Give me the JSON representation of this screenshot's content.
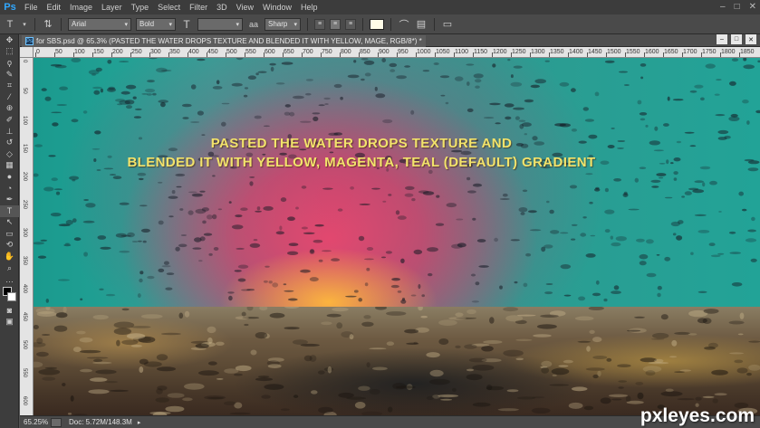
{
  "app": {
    "logo": "Ps"
  },
  "menu": [
    "File",
    "Edit",
    "Image",
    "Layer",
    "Type",
    "Select",
    "Filter",
    "3D",
    "View",
    "Window",
    "Help"
  ],
  "window_controls": [
    "–",
    "□",
    "✕"
  ],
  "options": {
    "font_family": "Arial",
    "font_style": "Bold",
    "font_size": "",
    "antialias": "Sharp",
    "color": "#fffde8"
  },
  "tools": [
    "move-icon",
    "marquee-icon",
    "lasso-icon",
    "quick-select-icon",
    "crop-icon",
    "eyedropper-icon",
    "healing-icon",
    "brush-icon",
    "stamp-icon",
    "history-brush-icon",
    "eraser-icon",
    "gradient-icon",
    "blur-icon",
    "dodge-icon",
    "pen-icon",
    "type-icon",
    "path-select-icon",
    "shape-icon",
    "hand-icon",
    "zoom-icon"
  ],
  "document": {
    "tab_title": "for SBS.psd @ 65.3% (PASTED THE WATER DROPS TEXTURE AND BLENDED IT WITH YELLOW, MAGE, RGB/8*) *"
  },
  "ruler": {
    "h_ticks": [
      "0",
      "50",
      "100",
      "150",
      "200",
      "250",
      "300",
      "350",
      "400",
      "450",
      "500",
      "550",
      "600",
      "650",
      "700",
      "750",
      "800",
      "850",
      "900",
      "950",
      "1000",
      "1050",
      "1100",
      "1150",
      "1200",
      "1250",
      "1300",
      "1350",
      "1400",
      "1450",
      "1500",
      "1550",
      "1600",
      "1650",
      "1700",
      "1750",
      "1800",
      "1850"
    ],
    "v_ticks": [
      "0",
      "50",
      "100",
      "150",
      "200",
      "250",
      "300",
      "350",
      "400",
      "450",
      "500",
      "550",
      "600"
    ]
  },
  "canvas": {
    "caption_line1": "PASTED THE WATER DROPS TEXTURE AND",
    "caption_line2": "BLENDED IT WITH YELLOW, MAGENTA, TEAL (DEFAULT) GRADIENT",
    "caption_color": "#f2e36b"
  },
  "status": {
    "zoom": "65.25%",
    "doc_size": "Doc: 5.72M/148.3M"
  },
  "watermark": "pxleyes.com"
}
